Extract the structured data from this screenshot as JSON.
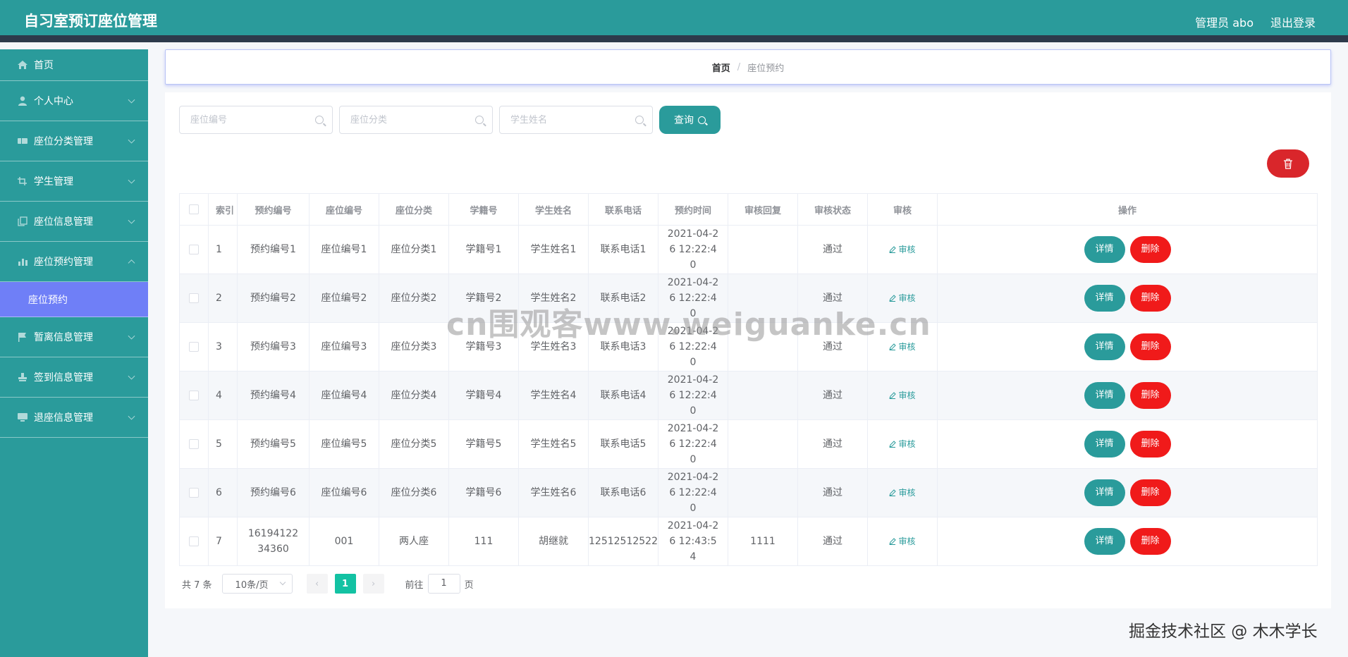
{
  "header": {
    "title": "自习室预订座位管理",
    "user": "管理员 abo",
    "logout": "退出登录"
  },
  "colors": {
    "primary": "#2a9b9b",
    "active_menu": "#6f7ff7",
    "danger": "#f01a1a",
    "pager_active": "#13c2a3"
  },
  "sidebar": {
    "items": [
      {
        "label": "首页",
        "icon": "home-icon"
      },
      {
        "label": "个人中心",
        "icon": "user-icon"
      },
      {
        "label": "座位分类管理",
        "icon": "ticket-icon"
      },
      {
        "label": "学生管理",
        "icon": "crop-icon"
      },
      {
        "label": "座位信息管理",
        "icon": "copy-icon"
      },
      {
        "label": "座位预约管理",
        "icon": "chart-icon",
        "expanded": true
      },
      {
        "label": "暂离信息管理",
        "icon": "flag-icon"
      },
      {
        "label": "签到信息管理",
        "icon": "stamp-icon"
      },
      {
        "label": "退座信息管理",
        "icon": "monitor-icon"
      }
    ],
    "sub_active": "座位预约"
  },
  "breadcrumb": {
    "home": "首页",
    "sep": "/",
    "current": "座位预约"
  },
  "search": {
    "seat_no_placeholder": "座位编号",
    "seat_type_placeholder": "座位分类",
    "student_name_placeholder": "学生姓名",
    "query_label": "查询"
  },
  "table": {
    "headers": [
      "索引",
      "预约编号",
      "座位编号",
      "座位分类",
      "学籍号",
      "学生姓名",
      "联系电话",
      "预约时间",
      "审核回复",
      "审核状态",
      "审核",
      "操作"
    ],
    "audit_label": "审核",
    "detail_label": "详情",
    "delete_label": "删除",
    "rows": [
      {
        "index": "1",
        "reservation_no": "预约编号1",
        "seat_no": "座位编号1",
        "seat_type": "座位分类1",
        "student_id": "学籍号1",
        "student_name": "学生姓名1",
        "phone": "联系电话1",
        "time": "2021-04-26 12:22:40",
        "reply": "",
        "status": "通过"
      },
      {
        "index": "2",
        "reservation_no": "预约编号2",
        "seat_no": "座位编号2",
        "seat_type": "座位分类2",
        "student_id": "学籍号2",
        "student_name": "学生姓名2",
        "phone": "联系电话2",
        "time": "2021-04-26 12:22:40",
        "reply": "",
        "status": "通过"
      },
      {
        "index": "3",
        "reservation_no": "预约编号3",
        "seat_no": "座位编号3",
        "seat_type": "座位分类3",
        "student_id": "学籍号3",
        "student_name": "学生姓名3",
        "phone": "联系电话3",
        "time": "2021-04-26 12:22:40",
        "reply": "",
        "status": "通过"
      },
      {
        "index": "4",
        "reservation_no": "预约编号4",
        "seat_no": "座位编号4",
        "seat_type": "座位分类4",
        "student_id": "学籍号4",
        "student_name": "学生姓名4",
        "phone": "联系电话4",
        "time": "2021-04-26 12:22:40",
        "reply": "",
        "status": "通过"
      },
      {
        "index": "5",
        "reservation_no": "预约编号5",
        "seat_no": "座位编号5",
        "seat_type": "座位分类5",
        "student_id": "学籍号5",
        "student_name": "学生姓名5",
        "phone": "联系电话5",
        "time": "2021-04-26 12:22:40",
        "reply": "",
        "status": "通过"
      },
      {
        "index": "6",
        "reservation_no": "预约编号6",
        "seat_no": "座位编号6",
        "seat_type": "座位分类6",
        "student_id": "学籍号6",
        "student_name": "学生姓名6",
        "phone": "联系电话6",
        "time": "2021-04-26 12:22:40",
        "reply": "",
        "status": "通过"
      },
      {
        "index": "7",
        "reservation_no": "1619412234360",
        "seat_no": "001",
        "seat_type": "两人座",
        "student_id": "111",
        "student_name": "胡继就",
        "phone": "12512512522",
        "time": "2021-04-26 12:43:54",
        "reply": "1111",
        "status": "通过"
      }
    ]
  },
  "pagination": {
    "total": "共 7 条",
    "page_size": "10条/页",
    "current_page": "1",
    "goto_prefix": "前往",
    "goto_value": "1",
    "goto_suffix": "页"
  },
  "watermarks": {
    "center": "cn围观客www.weiguanke.cn",
    "corner": "掘金技术社区 @ 木木学长"
  }
}
